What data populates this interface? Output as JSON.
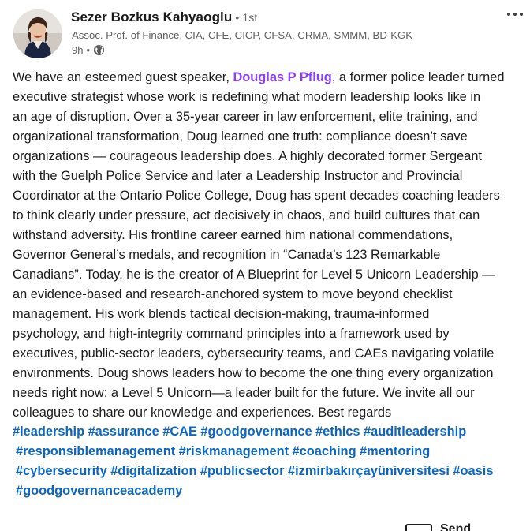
{
  "author": {
    "name": "Sezer Bozkus Kahyaoglu",
    "degree": "• 1st",
    "headline": "Assoc. Prof. of Finance, CIA, CFE, CICP, CFSA, CRMA, SMMM, BD-KGK",
    "time": "9h",
    "separator": "•"
  },
  "icons": {
    "avatar": "profile-photo",
    "visibility": "globe-icon",
    "menu": "more-options-icon",
    "send": "send-icon"
  },
  "post": {
    "lines": [
      [
        "We have an esteemed guest speaker, ",
        "Douglas P Pflug",
        ", a former police leader turned"
      ],
      [
        "executive strategist whose work is redefining what modern leadership looks like in"
      ],
      [
        "an age of disruption. Over a 35-year career in law enforcement, elite training, and"
      ],
      [
        "organizational transformation, Doug learned one truth: compliance doesn’t save"
      ],
      [
        "organizations — courageous leadership does. A highly decorated former Sergeant"
      ],
      [
        "with the Guelph Police Service and later a Leadership Instructor and Provincial"
      ],
      [
        "Coordinator at the Ontario Police College, Doug has spent decades coaching leaders"
      ],
      [
        "to think clearly under pressure, act decisively in chaos, and build cultures that can"
      ],
      [
        "withstand adversity. His frontline career earned him national commendations,"
      ],
      [
        "Governor General’s medals, and recognition in “Canada’s 123 Remarkable"
      ],
      [
        "Canadians”. Today, he is the creator of A Blueprint for Level 5 Unicorn Leadership —"
      ],
      [
        "an evidence-based and research-anchored system to move beyond checklist"
      ],
      [
        "management. His work blends tactical decision-making, trauma-informed"
      ],
      [
        "psychology, and high-integrity command principles into a framework used by"
      ],
      [
        "executives, public-sector leaders, cybersecurity teams, and CAEs navigating volatile"
      ],
      [
        "environments. Doug shows leaders how to become the one thing every organization"
      ],
      [
        "needs right now: a Level 5 Unicorn—a leader built for the future. We invite all our"
      ],
      [
        "colleagues to share our knowledge and experiences. Best regards"
      ]
    ],
    "hashtag_lines": [
      [
        "#leadership",
        "#assurance",
        "#CAE",
        "#goodgovernance",
        "#ethics",
        "#auditleadership"
      ],
      [
        "#responsiblemanagement",
        "#riskmanagement",
        "#coaching",
        "#mentoring"
      ],
      [
        "#cybersecurity",
        "#digitalization",
        "#publicsector",
        "#izmirbakırçayüniversitesi",
        "#oasis"
      ],
      [
        "#goodgovernanceacademy"
      ]
    ]
  },
  "actions": {
    "send_label": "Send"
  }
}
